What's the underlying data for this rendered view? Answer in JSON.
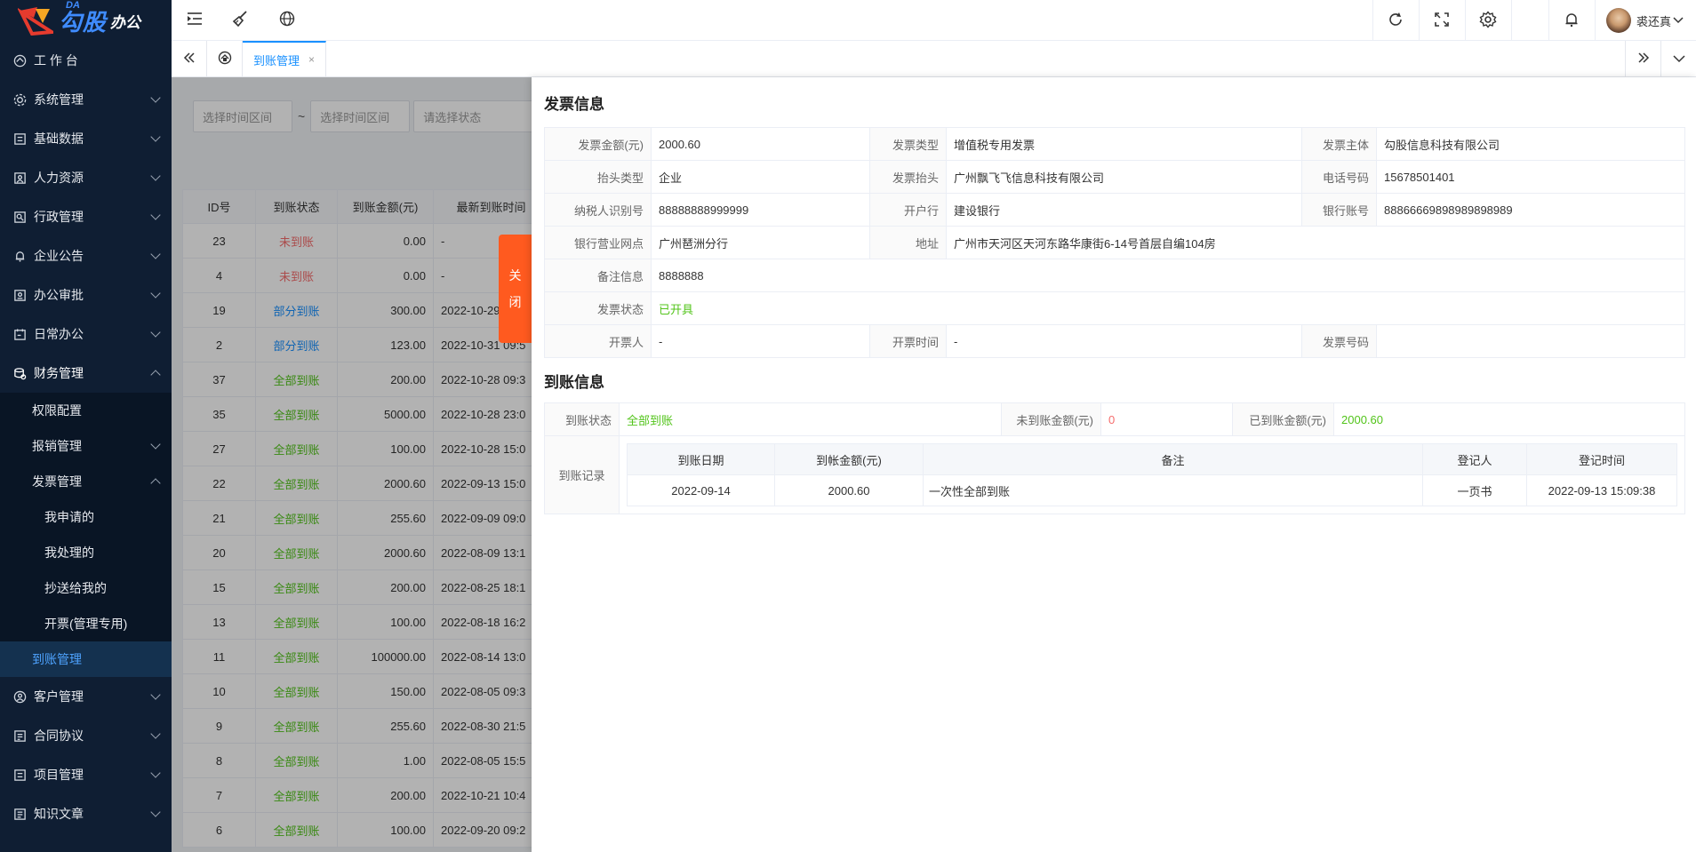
{
  "app": {
    "logo_main": "勾股",
    "logo_sub": "办公",
    "logo_da": "DA"
  },
  "sidebar": {
    "items": [
      {
        "label": "工 作 台",
        "icon": "dashboard-icon"
      },
      {
        "label": "系统管理",
        "icon": "settings-icon"
      },
      {
        "label": "基础数据",
        "icon": "data-icon"
      },
      {
        "label": "人力资源",
        "icon": "user-icon"
      },
      {
        "label": "行政管理",
        "icon": "admin-icon"
      },
      {
        "label": "企业公告",
        "icon": "bell-icon"
      },
      {
        "label": "办公审批",
        "icon": "approval-icon"
      },
      {
        "label": "日常办公",
        "icon": "calendar-icon"
      },
      {
        "label": "财务管理",
        "icon": "finance-icon"
      },
      {
        "label": "客户管理",
        "icon": "customer-icon"
      },
      {
        "label": "合同协议",
        "icon": "contract-icon"
      },
      {
        "label": "项目管理",
        "icon": "project-icon"
      },
      {
        "label": "知识文章",
        "icon": "article-icon"
      }
    ],
    "finance_sub": {
      "perm": "权限配置",
      "reimburse": "报销管理",
      "invoice": "发票管理",
      "invoice_children": [
        "我申请的",
        "我处理的",
        "抄送给我的",
        "开票(管理专用)"
      ],
      "arrival": "到账管理"
    }
  },
  "header": {
    "user_name": "裘还真"
  },
  "tabs": {
    "active": "到账管理",
    "close": "×"
  },
  "filters": {
    "start_placeholder": "选择时间区间",
    "tilde": "~",
    "end_placeholder": "选择时间区间",
    "status_placeholder": "请选择状态"
  },
  "list": {
    "headers": [
      "ID号",
      "到账状态",
      "到账金额(元)",
      "最新到账时间"
    ],
    "rows": [
      [
        "23",
        "未到账",
        "0.00",
        "-"
      ],
      [
        "4",
        "未到账",
        "0.00",
        "-"
      ],
      [
        "19",
        "部分到账",
        "300.00",
        "2022-10-29"
      ],
      [
        "2",
        "部分到账",
        "123.00",
        "2022-10-31 09:5"
      ],
      [
        "37",
        "全部到账",
        "200.00",
        "2022-10-28 09:3"
      ],
      [
        "35",
        "全部到账",
        "5000.00",
        "2022-10-28 23:0"
      ],
      [
        "27",
        "全部到账",
        "100.00",
        "2022-10-28 15:0"
      ],
      [
        "22",
        "全部到账",
        "2000.60",
        "2022-09-13 15:0"
      ],
      [
        "21",
        "全部到账",
        "255.60",
        "2022-09-09 09:0"
      ],
      [
        "20",
        "全部到账",
        "2000.60",
        "2022-08-09 13:1"
      ],
      [
        "15",
        "全部到账",
        "200.00",
        "2022-08-25 18:1"
      ],
      [
        "13",
        "全部到账",
        "100.00",
        "2022-08-18 16:2"
      ],
      [
        "11",
        "全部到账",
        "100000.00",
        "2022-08-14 13:0"
      ],
      [
        "10",
        "全部到账",
        "150.00",
        "2022-08-05 09:3"
      ],
      [
        "9",
        "全部到账",
        "255.60",
        "2022-08-30 21:5"
      ],
      [
        "8",
        "全部到账",
        "1.00",
        "2022-08-05 15:5"
      ],
      [
        "7",
        "全部到账",
        "200.00",
        "2022-10-21 10:4"
      ],
      [
        "6",
        "全部到账",
        "100.00",
        "2022-09-20 09:2"
      ]
    ]
  },
  "close_tab": {
    "line1": "关",
    "line2": "闭"
  },
  "invoice": {
    "title": "发票信息",
    "amount_label": "发票金额(元)",
    "amount": "2000.60",
    "type_label": "发票类型",
    "type": "增值税专用发票",
    "subject_label": "发票主体",
    "subject": "勾股信息科技有限公司",
    "head_type_label": "抬头类型",
    "head_type": "企业",
    "head_label": "发票抬头",
    "head": "广州飘飞飞信息科技有限公司",
    "phone_label": "电话号码",
    "phone": "15678501401",
    "taxid_label": "纳税人识别号",
    "taxid": "88888888999999",
    "bank_label": "开户行",
    "bank": "建设银行",
    "account_label": "银行账号",
    "account": "88866669898989898989",
    "branch_label": "银行营业网点",
    "branch": "广州琶洲分行",
    "addr_label": "地址",
    "addr": "广州市天河区天河东路华康街6-14号首层自编104房",
    "remark_label": "备注信息",
    "remark": "8888888",
    "status_label": "发票状态",
    "status": "已开具",
    "drawer_label": "开票人",
    "drawer": "-",
    "time_label": "开票时间",
    "time": "-",
    "number_label": "发票号码",
    "number": ""
  },
  "arrival": {
    "title": "到账信息",
    "status_label": "到账状态",
    "status": "全部到账",
    "unpaid_label": "未到账金额(元)",
    "unpaid": "0",
    "paid_label": "已到账金额(元)",
    "paid": "2000.60",
    "records_label": "到账记录",
    "record_headers": [
      "到账日期",
      "到帐金额(元)",
      "备注",
      "登记人",
      "登记时间"
    ],
    "records": [
      [
        "2022-09-14",
        "2000.60",
        "一次性全部到账",
        "一页书",
        "2022-09-13 15:09:38"
      ]
    ]
  }
}
